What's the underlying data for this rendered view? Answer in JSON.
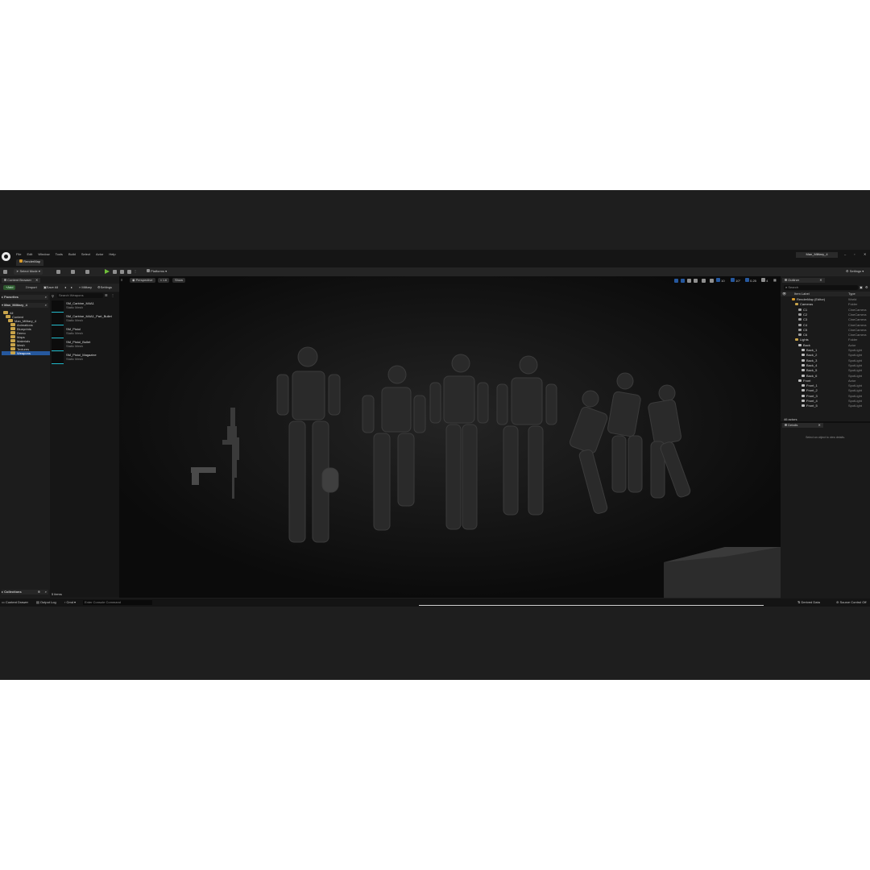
{
  "menu": [
    "File",
    "Edit",
    "Window",
    "Tools",
    "Build",
    "Select",
    "Actor",
    "Help"
  ],
  "project_name": "Man_Military_4",
  "level_tab": "RenderMap",
  "toolbar": {
    "select_mode": "Select Mode",
    "platforms": "Platforms",
    "settings": "Settings"
  },
  "content_browser": {
    "tab": "Content Browser",
    "add": "Add",
    "import": "Import",
    "save_all": "Save All",
    "breadcrumb": "Military",
    "settings": "Settings",
    "search_placeholder": "Search Weapons",
    "favorites": "Favorites",
    "root": "Man_Military_4",
    "tree": [
      "All",
      "Content",
      "Man_Military_4",
      "Animations",
      "Blueprints",
      "Demo",
      "Maps",
      "Materials",
      "Mesh",
      "Textures",
      "Weapons"
    ],
    "collections": "Collections",
    "items_count": "5 items",
    "assets": [
      {
        "name": "SM_Carbine_M4A1",
        "type": "Static Mesh"
      },
      {
        "name": "SM_Carbine_M4A1_Part_Bullet",
        "type": "Static Mesh"
      },
      {
        "name": "SM_Pistol",
        "type": "Static Mesh"
      },
      {
        "name": "SM_Pistol_Bullet",
        "type": "Static Mesh"
      },
      {
        "name": "SM_Pistol_Magazine",
        "type": "Static Mesh"
      }
    ]
  },
  "viewport": {
    "perspective": "Perspective",
    "lit": "Lit",
    "show": "Show",
    "grid_snap": "10",
    "angle_snap": "10°",
    "scale_snap": "0.25",
    "camera_speed": "4"
  },
  "outliner": {
    "tab": "Outliner",
    "search_placeholder": "Search",
    "col_label": "Item Label",
    "col_type": "Type",
    "rows": [
      {
        "label": "RenderMap (Editor)",
        "type": "World",
        "depth": 1,
        "kind": "world"
      },
      {
        "label": "Cameras",
        "type": "Folder",
        "depth": 2,
        "kind": "folder"
      },
      {
        "label": "C1",
        "type": "CineCamera",
        "depth": 3,
        "kind": "cam"
      },
      {
        "label": "C2",
        "type": "CineCamera",
        "depth": 3,
        "kind": "cam"
      },
      {
        "label": "C3",
        "type": "CineCamera",
        "depth": 3,
        "kind": "cam"
      },
      {
        "label": "C4",
        "type": "CineCamera",
        "depth": 3,
        "kind": "cam"
      },
      {
        "label": "C5",
        "type": "CineCamera",
        "depth": 3,
        "kind": "cam"
      },
      {
        "label": "C6",
        "type": "CineCamera",
        "depth": 3,
        "kind": "cam"
      },
      {
        "label": "Lights",
        "type": "Folder",
        "depth": 2,
        "kind": "folder"
      },
      {
        "label": "Back",
        "type": "Actor",
        "depth": 3,
        "kind": "actor"
      },
      {
        "label": "Back_1",
        "type": "SpotLight",
        "depth": 4,
        "kind": "light"
      },
      {
        "label": "Back_2",
        "type": "SpotLight",
        "depth": 4,
        "kind": "light"
      },
      {
        "label": "Back_3",
        "type": "SpotLight",
        "depth": 4,
        "kind": "light"
      },
      {
        "label": "Back_4",
        "type": "SpotLight",
        "depth": 4,
        "kind": "light"
      },
      {
        "label": "Back_5",
        "type": "SpotLight",
        "depth": 4,
        "kind": "light"
      },
      {
        "label": "Back_6",
        "type": "SpotLight",
        "depth": 4,
        "kind": "light"
      },
      {
        "label": "Front",
        "type": "Actor",
        "depth": 3,
        "kind": "actor"
      },
      {
        "label": "Front_1",
        "type": "SpotLight",
        "depth": 4,
        "kind": "light"
      },
      {
        "label": "Front_2",
        "type": "SpotLight",
        "depth": 4,
        "kind": "light"
      },
      {
        "label": "Front_3",
        "type": "SpotLight",
        "depth": 4,
        "kind": "light"
      },
      {
        "label": "Front_4",
        "type": "SpotLight",
        "depth": 4,
        "kind": "light"
      },
      {
        "label": "Front_5",
        "type": "SpotLight",
        "depth": 4,
        "kind": "light"
      }
    ],
    "actor_count": "46 actors"
  },
  "details": {
    "tab": "Details",
    "empty_message": "Select an object to view details."
  },
  "status_bar": {
    "content_drawer": "Content Drawer",
    "output_log": "Output Log",
    "cmd": "Cmd",
    "console_placeholder": "Enter Console Command",
    "derived_data": "Derived Data",
    "source_control": "Source Control Off"
  },
  "colors": {
    "accent": "#26589e",
    "play": "#6fbf3a",
    "folder": "#c9a44a",
    "panel": "#1a1a1a",
    "viewport": "#111111"
  }
}
